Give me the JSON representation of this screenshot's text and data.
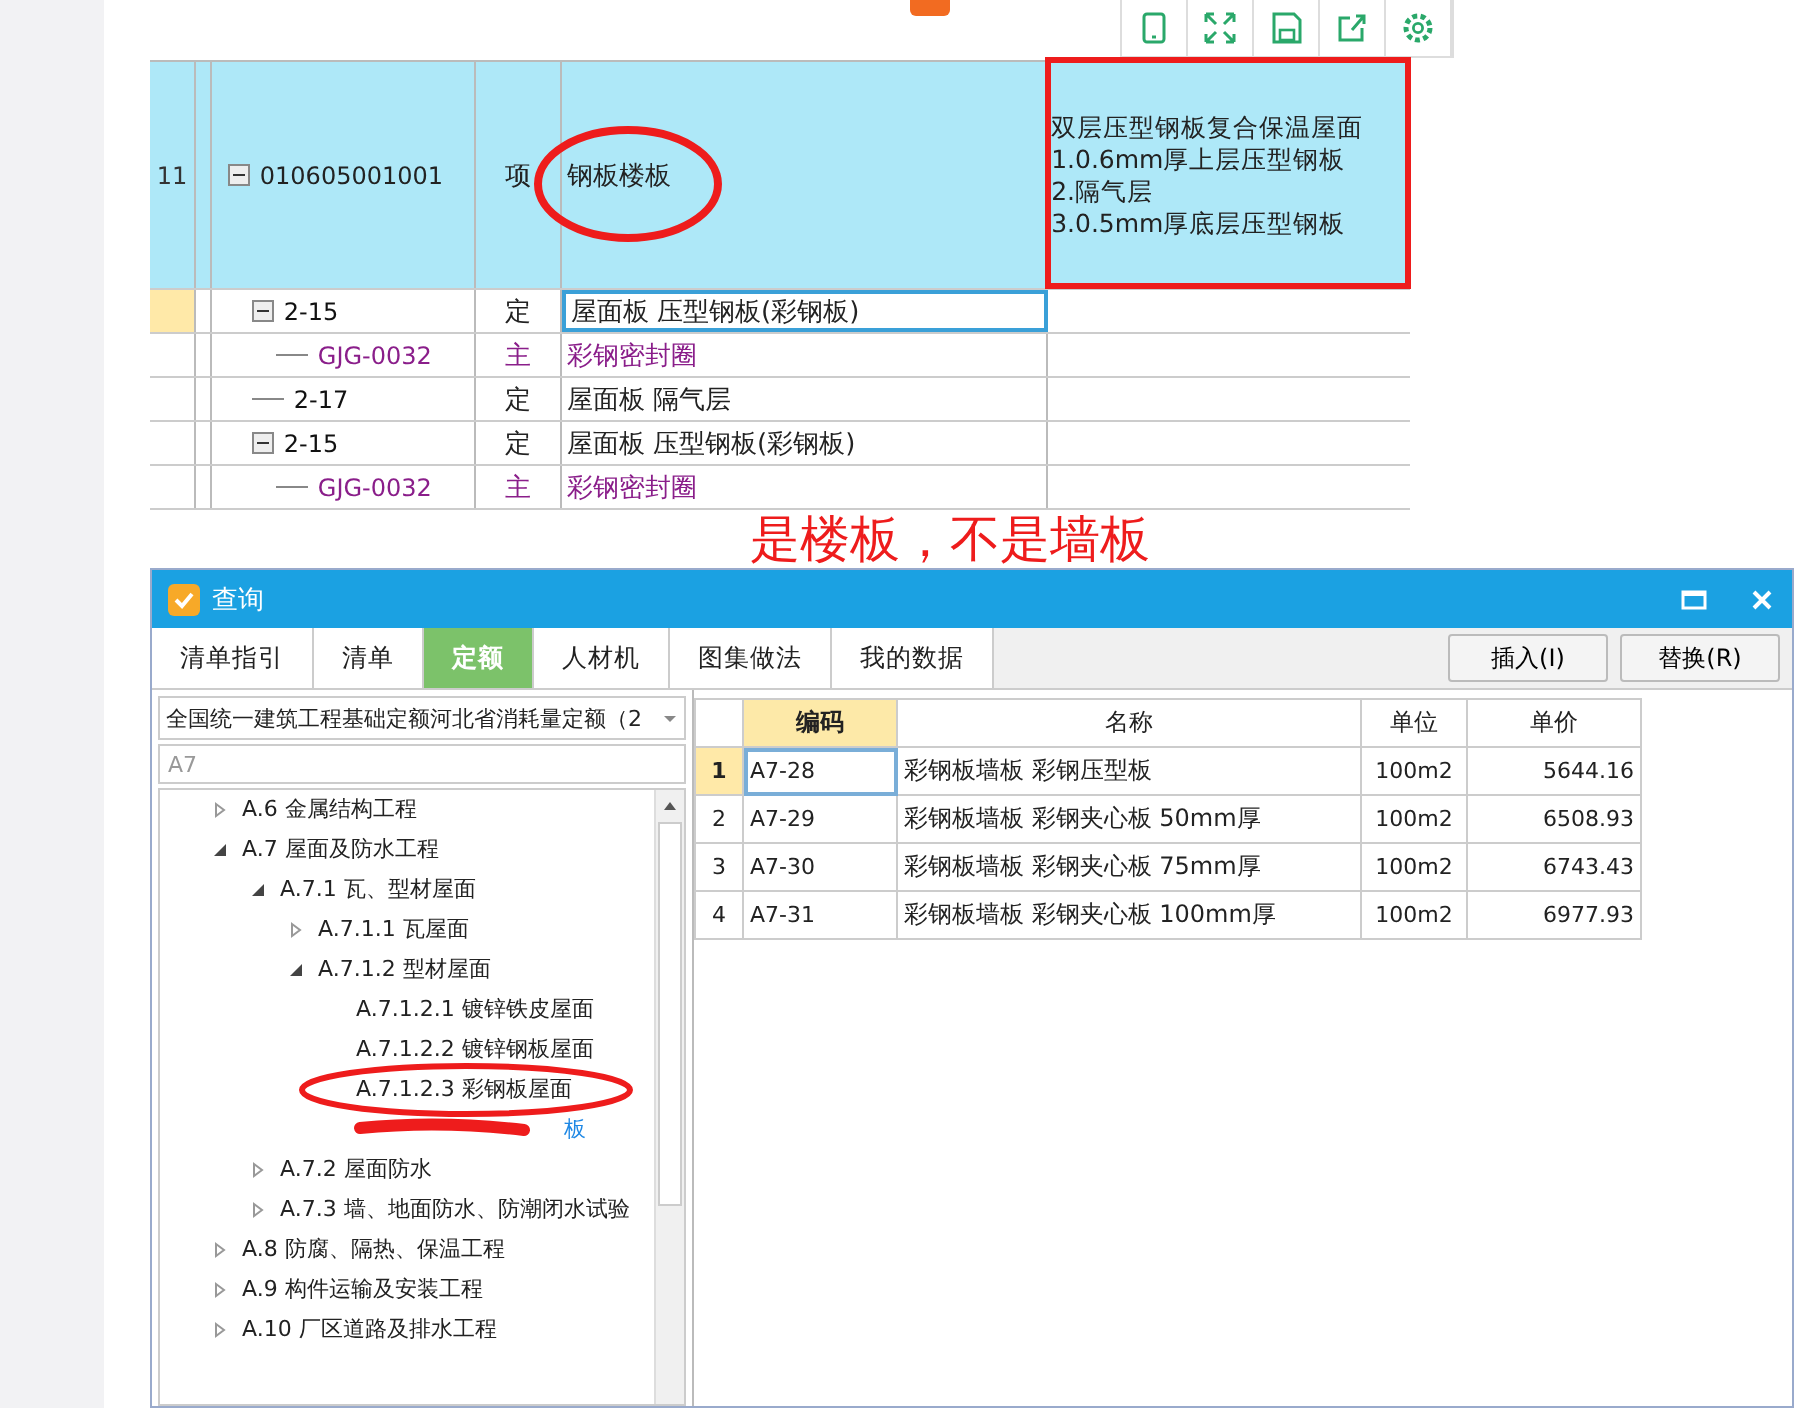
{
  "grid": {
    "rows": [
      {
        "number": "11",
        "code": "010605001001",
        "type": "项",
        "name": "钢板楼板",
        "kind": "item",
        "expanded": true,
        "selected": false,
        "feature": [
          "双层压型钢板复合保温屋面",
          "1.0.6mm厚上层压型钢板",
          "2.隔气层",
          "3.0.5mm厚底层压型钢板"
        ],
        "children": [
          {
            "code": "2-15",
            "type": "定",
            "name": "屋面板 压型钢板(彩钢板)",
            "kind": "quota",
            "expanded": true,
            "selected": true,
            "children": [
              {
                "code": "GJG-0032",
                "type": "主",
                "name": "彩钢密封圈",
                "kind": "material",
                "selected": false
              }
            ]
          },
          {
            "code": "2-17",
            "type": "定",
            "name": "屋面板 隔气层",
            "kind": "quota",
            "selected": false
          },
          {
            "code": "2-15",
            "type": "定",
            "name": "屋面板 压型钢板(彩钢板)",
            "kind": "quota",
            "expanded": true,
            "selected": false,
            "children": [
              {
                "code": "GJG-0032",
                "type": "主",
                "name": "彩钢密封圈",
                "kind": "material",
                "selected": false
              }
            ]
          }
        ]
      }
    ]
  },
  "annotation": "是楼板，不是墙板",
  "dialog": {
    "title": "查询",
    "tabs": [
      {
        "label": "清单指引",
        "selected": false
      },
      {
        "label": "清单",
        "selected": false
      },
      {
        "label": "定额",
        "selected": true
      },
      {
        "label": "人材机",
        "selected": false
      },
      {
        "label": "图集做法",
        "selected": false
      },
      {
        "label": "我的数据",
        "selected": false
      }
    ],
    "buttons": [
      "插入(I)",
      "替换(R)"
    ],
    "dropdown": {
      "value": "全国统一建筑工程基础定额河北省消耗量定额（2"
    },
    "search": {
      "placeholder": "A7"
    },
    "tree": [
      {
        "label": "A.6 金属结构工程",
        "expanded": false
      },
      {
        "label": "A.7 屋面及防水工程",
        "expanded": true,
        "children": [
          {
            "label": "A.7.1 瓦、型材屋面",
            "expanded": true,
            "children": [
              {
                "label": "A.7.1.1 瓦屋面",
                "expanded": false
              },
              {
                "label": "A.7.1.2 型材屋面",
                "expanded": true,
                "children": [
                  {
                    "label": "A.7.1.2.1 镀锌铁皮屋面"
                  },
                  {
                    "label": "A.7.1.2.2 镀锌钢板屋面"
                  },
                  {
                    "label": "A.7.1.2.3 彩钢板屋面"
                  },
                  {
                    "label": "板",
                    "kind": "link"
                  }
                ]
              }
            ]
          },
          {
            "label": "A.7.2 屋面防水",
            "expanded": false
          },
          {
            "label": "A.7.3 墙、地面防水、防潮闭水试验",
            "expanded": false
          }
        ]
      },
      {
        "label": "A.8 防腐、隔热、保温工程",
        "expanded": false
      },
      {
        "label": "A.9 构件运输及安装工程",
        "expanded": false
      },
      {
        "label": "A.10 厂区道路及排水工程",
        "expanded": false
      }
    ],
    "table": {
      "columns": [
        "编码",
        "名称",
        "单位",
        "单价"
      ],
      "rows": [
        {
          "number": "1",
          "code": "A7-28",
          "name": "彩钢板墙板 彩钢压型板",
          "unit": "100m2",
          "price": "5644.16",
          "selected": true
        },
        {
          "number": "2",
          "code": "A7-29",
          "name": "彩钢板墙板 彩钢夹心板 50mm厚",
          "unit": "100m2",
          "price": "6508.93",
          "selected": false
        },
        {
          "number": "3",
          "code": "A7-30",
          "name": "彩钢板墙板 彩钢夹心板 75mm厚",
          "unit": "100m2",
          "price": "6743.43",
          "selected": false
        },
        {
          "number": "4",
          "code": "A7-31",
          "name": "彩钢板墙板 彩钢夹心板 100mm厚",
          "unit": "100m2",
          "price": "6977.93",
          "selected": false
        }
      ]
    }
  }
}
